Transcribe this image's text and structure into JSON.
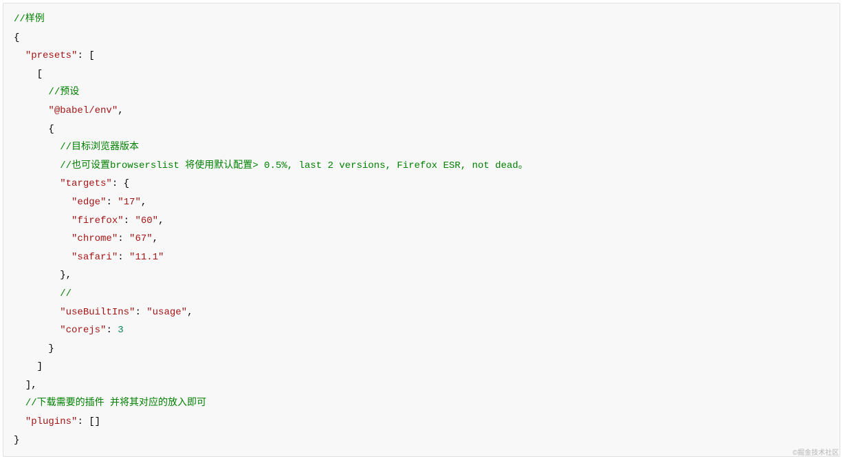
{
  "code": {
    "lines": [
      {
        "indent": 0,
        "tokens": [
          {
            "cls": "c-green",
            "t": "//样例"
          }
        ]
      },
      {
        "indent": 0,
        "tokens": [
          {
            "cls": "c-black",
            "t": "{"
          }
        ]
      },
      {
        "indent": 1,
        "tokens": [
          {
            "cls": "c-maroon",
            "t": "\"presets\""
          },
          {
            "cls": "c-black",
            "t": ": ["
          }
        ]
      },
      {
        "indent": 2,
        "tokens": [
          {
            "cls": "c-black",
            "t": "["
          }
        ]
      },
      {
        "indent": 3,
        "tokens": [
          {
            "cls": "c-green",
            "t": "//预设"
          }
        ]
      },
      {
        "indent": 3,
        "tokens": [
          {
            "cls": "c-maroon",
            "t": "\"@babel/env\""
          },
          {
            "cls": "c-black",
            "t": ","
          }
        ]
      },
      {
        "indent": 3,
        "tokens": [
          {
            "cls": "c-black",
            "t": "{"
          }
        ]
      },
      {
        "indent": 4,
        "tokens": [
          {
            "cls": "c-green",
            "t": "//目标浏览器版本"
          }
        ]
      },
      {
        "indent": 4,
        "tokens": [
          {
            "cls": "c-green",
            "t": "//也可设置browserslist 将使用默认配置> 0.5%, last 2 versions, Firefox ESR, not dead。"
          }
        ]
      },
      {
        "indent": 4,
        "tokens": [
          {
            "cls": "c-maroon",
            "t": "\"targets\""
          },
          {
            "cls": "c-black",
            "t": ": {"
          }
        ]
      },
      {
        "indent": 5,
        "tokens": [
          {
            "cls": "c-maroon",
            "t": "\"edge\""
          },
          {
            "cls": "c-black",
            "t": ": "
          },
          {
            "cls": "c-maroon",
            "t": "\"17\""
          },
          {
            "cls": "c-black",
            "t": ","
          }
        ]
      },
      {
        "indent": 5,
        "tokens": [
          {
            "cls": "c-maroon",
            "t": "\"firefox\""
          },
          {
            "cls": "c-black",
            "t": ": "
          },
          {
            "cls": "c-maroon",
            "t": "\"60\""
          },
          {
            "cls": "c-black",
            "t": ","
          }
        ]
      },
      {
        "indent": 5,
        "tokens": [
          {
            "cls": "c-maroon",
            "t": "\"chrome\""
          },
          {
            "cls": "c-black",
            "t": ": "
          },
          {
            "cls": "c-maroon",
            "t": "\"67\""
          },
          {
            "cls": "c-black",
            "t": ","
          }
        ]
      },
      {
        "indent": 5,
        "tokens": [
          {
            "cls": "c-maroon",
            "t": "\"safari\""
          },
          {
            "cls": "c-black",
            "t": ": "
          },
          {
            "cls": "c-maroon",
            "t": "\"11.1\""
          }
        ]
      },
      {
        "indent": 4,
        "tokens": [
          {
            "cls": "c-black",
            "t": "},"
          }
        ]
      },
      {
        "indent": 4,
        "tokens": [
          {
            "cls": "c-green",
            "t": "//"
          }
        ]
      },
      {
        "indent": 4,
        "tokens": [
          {
            "cls": "c-maroon",
            "t": "\"useBuiltIns\""
          },
          {
            "cls": "c-black",
            "t": ": "
          },
          {
            "cls": "c-maroon",
            "t": "\"usage\""
          },
          {
            "cls": "c-black",
            "t": ","
          }
        ]
      },
      {
        "indent": 4,
        "tokens": [
          {
            "cls": "c-maroon",
            "t": "\"corejs\""
          },
          {
            "cls": "c-black",
            "t": ": "
          },
          {
            "cls": "c-teal",
            "t": "3"
          }
        ]
      },
      {
        "indent": 3,
        "tokens": [
          {
            "cls": "c-black",
            "t": "}"
          }
        ]
      },
      {
        "indent": 2,
        "tokens": [
          {
            "cls": "c-black",
            "t": "]"
          }
        ]
      },
      {
        "indent": 1,
        "tokens": [
          {
            "cls": "c-black",
            "t": "],"
          }
        ]
      },
      {
        "indent": 1,
        "tokens": [
          {
            "cls": "c-green",
            "t": "//下载需要的插件 并将其对应的放入即可"
          }
        ]
      },
      {
        "indent": 1,
        "tokens": [
          {
            "cls": "c-maroon",
            "t": "\"plugins\""
          },
          {
            "cls": "c-black",
            "t": ": []"
          }
        ]
      },
      {
        "indent": 0,
        "tokens": [
          {
            "cls": "c-black",
            "t": "}"
          }
        ]
      }
    ],
    "indent_unit": "  "
  },
  "watermark": "©掘金技术社区"
}
